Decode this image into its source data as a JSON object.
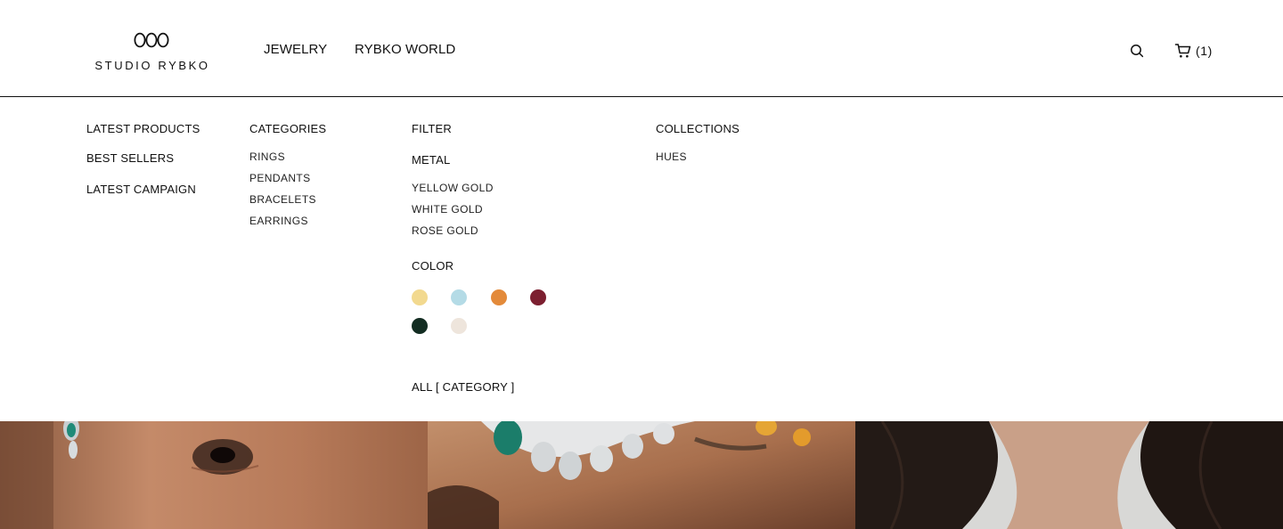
{
  "header": {
    "logo_text": "STUDIO RYBKO",
    "nav": {
      "jewelry": "JEWELRY",
      "world": "RYBKO WORLD"
    },
    "cart_count": "(1)"
  },
  "menu": {
    "col1": {
      "latest_products": "LATEST PRODUCTS",
      "best_sellers": "BEST SELLERS",
      "latest_campaign": "LATEST CAMPAIGN"
    },
    "categories": {
      "heading": "CATEGORIES",
      "items": [
        "RINGS",
        "PENDANTS",
        "BRACELETS",
        "EARRINGS"
      ]
    },
    "filter": {
      "heading": "FILTER",
      "metal_heading": "METAL",
      "metals": [
        "YELLOW GOLD",
        "WHITE GOLD",
        "ROSE GOLD"
      ],
      "color_heading": "COLOR",
      "colors": [
        "#f2d98f",
        "#b4dbe6",
        "#e38a3a",
        "#7c1f30",
        "#132d22",
        "#eee5dc"
      ],
      "all_link": "ALL [ CATEGORY ]"
    },
    "collections": {
      "heading": "COLLECTIONS",
      "items": [
        "HUES"
      ]
    }
  },
  "icons": {
    "logo": "three-rings-logo-icon",
    "search": "search-icon",
    "cart": "cart-icon"
  }
}
